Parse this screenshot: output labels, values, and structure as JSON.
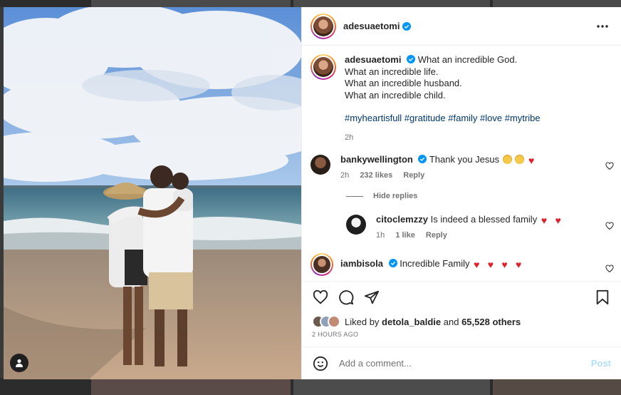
{
  "colors": {
    "link": "#00376b",
    "verified": "#0095f6",
    "heart": "#e0202a",
    "post_disabled": "#b2dffc",
    "muted": "#737373"
  },
  "post": {
    "author": "adesuaetomi",
    "caption_lines": [
      "What an incredible God.",
      "What an incredible life.",
      "What an incredible husband.",
      "What an incredible child."
    ],
    "hashtags": "#myheartisfull #gratitude #family #love #mytribe",
    "time": "2h"
  },
  "comments": [
    {
      "user": "bankywellington",
      "text": "Thank you Jesus",
      "time": "2h",
      "likes": "232 likes",
      "reply": "Reply"
    },
    {
      "user": "citoclemzzy",
      "text": "Is indeed a blessed family",
      "time": "1h",
      "likes": "1 like",
      "reply": "Reply"
    },
    {
      "user": "iambisola",
      "text": "Incredible Family"
    }
  ],
  "hide_replies": "Hide replies",
  "liked_by": {
    "prefix": "Liked by",
    "user": "detola_baldie",
    "and": "and",
    "others": "65,528 others"
  },
  "posted_ago": "2 HOURS AGO",
  "add_comment": {
    "placeholder": "Add a comment...",
    "post": "Post"
  },
  "icons": [
    "heart-icon",
    "comment-icon",
    "share-icon",
    "bookmark-icon",
    "more-icon",
    "emoji-icon",
    "user-tag-icon",
    "verified-icon"
  ]
}
